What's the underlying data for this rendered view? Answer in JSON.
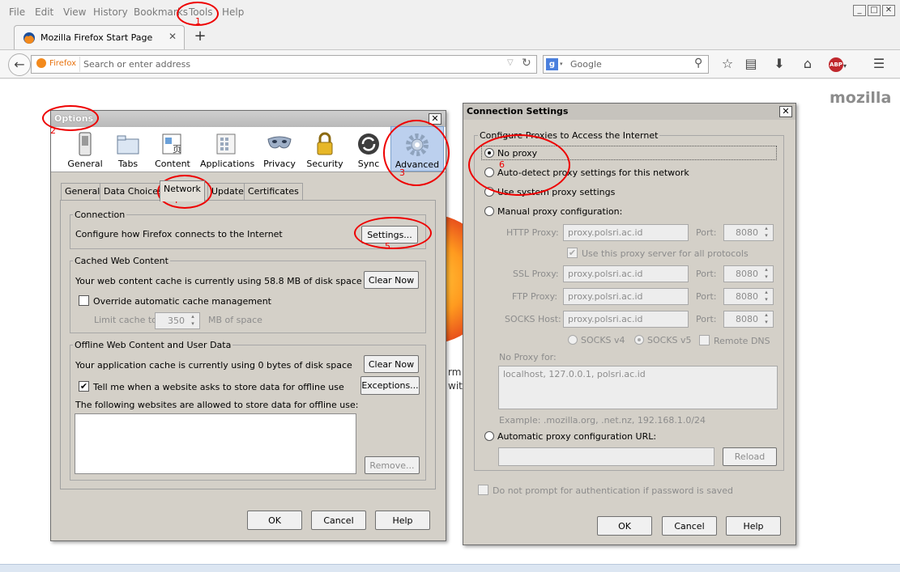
{
  "menu": [
    "File",
    "Edit",
    "View",
    "History",
    "Bookmarks",
    "Tools",
    "Help"
  ],
  "tab": {
    "title": "Mozilla Firefox Start Page"
  },
  "urlbar": {
    "identity": "Firefox",
    "placeholder": "Search or enter address"
  },
  "searchbar": {
    "engine": "Google"
  },
  "page": {
    "brand": "mozilla",
    "frag1": "rm c",
    "frag2": "with"
  },
  "options": {
    "title": "Options",
    "panes": [
      "General",
      "Tabs",
      "Content",
      "Applications",
      "Privacy",
      "Security",
      "Sync",
      "Advanced"
    ],
    "selected_pane": "Advanced",
    "subtabs": [
      "General",
      "Data Choices",
      "Network",
      "Update",
      "Certificates"
    ],
    "selected_subtab": "Network",
    "connection": {
      "legend": "Connection",
      "text": "Configure how Firefox connects to the Internet",
      "settings_button": "Settings..."
    },
    "cache": {
      "legend": "Cached Web Content",
      "text": "Your web content cache is currently using 58.8 MB of disk space",
      "clear_button": "Clear Now",
      "override_label": "Override automatic cache management",
      "override_checked": false,
      "limit_label": "Limit cache to",
      "limit_value": "350",
      "limit_unit": "MB of space"
    },
    "offline": {
      "legend": "Offline Web Content and User Data",
      "text": "Your application cache is currently using 0 bytes of disk space",
      "clear_button": "Clear Now",
      "tell_label": "Tell me when a website asks to store data for offline use",
      "tell_checked": true,
      "exceptions_button": "Exceptions...",
      "allowed_label": "The following websites are allowed to store data for offline use:",
      "remove_button": "Remove..."
    },
    "buttons": {
      "ok": "OK",
      "cancel": "Cancel",
      "help": "Help"
    }
  },
  "connection_settings": {
    "title": "Connection Settings",
    "legend": "Configure Proxies to Access the Internet",
    "options": {
      "no_proxy": "No proxy",
      "auto_detect": "Auto-detect proxy settings for this network",
      "system": "Use system proxy settings",
      "manual": "Manual proxy configuration:",
      "auto_url": "Automatic proxy configuration URL:"
    },
    "selected": "No proxy",
    "http_proxy": {
      "label": "HTTP Proxy:",
      "value": "proxy.polsri.ac.id",
      "port_label": "Port:",
      "port": "8080"
    },
    "same_proxy_label": "Use this proxy server for all protocols",
    "same_proxy_checked": true,
    "ssl_proxy": {
      "label": "SSL Proxy:",
      "value": "proxy.polsri.ac.id",
      "port_label": "Port:",
      "port": "8080"
    },
    "ftp_proxy": {
      "label": "FTP Proxy:",
      "value": "proxy.polsri.ac.id",
      "port_label": "Port:",
      "port": "8080"
    },
    "socks_host": {
      "label": "SOCKS Host:",
      "value": "proxy.polsri.ac.id",
      "port_label": "Port:",
      "port": "8080"
    },
    "socks_v4": "SOCKS v4",
    "socks_v5": "SOCKS v5",
    "socks_selected": "SOCKS v5",
    "remote_dns": "Remote DNS",
    "no_proxy_for_label": "No Proxy for:",
    "no_proxy_for_value": "localhost, 127.0.0.1, polsri.ac.id",
    "example": "Example: .mozilla.org, .net.nz, 192.168.1.0/24",
    "reload_button": "Reload",
    "no_prompt_label": "Do not prompt for authentication if password is saved",
    "buttons": {
      "ok": "OK",
      "cancel": "Cancel",
      "help": "Help"
    }
  },
  "annotations": [
    "1",
    "2",
    "3",
    "4",
    "5",
    "6"
  ],
  "colors": {
    "annotation": "#e00000",
    "selected_pane_bg": "#bcd0ee",
    "title_active": "#c8c8c8",
    "title_conn": "#b8b8b8"
  }
}
